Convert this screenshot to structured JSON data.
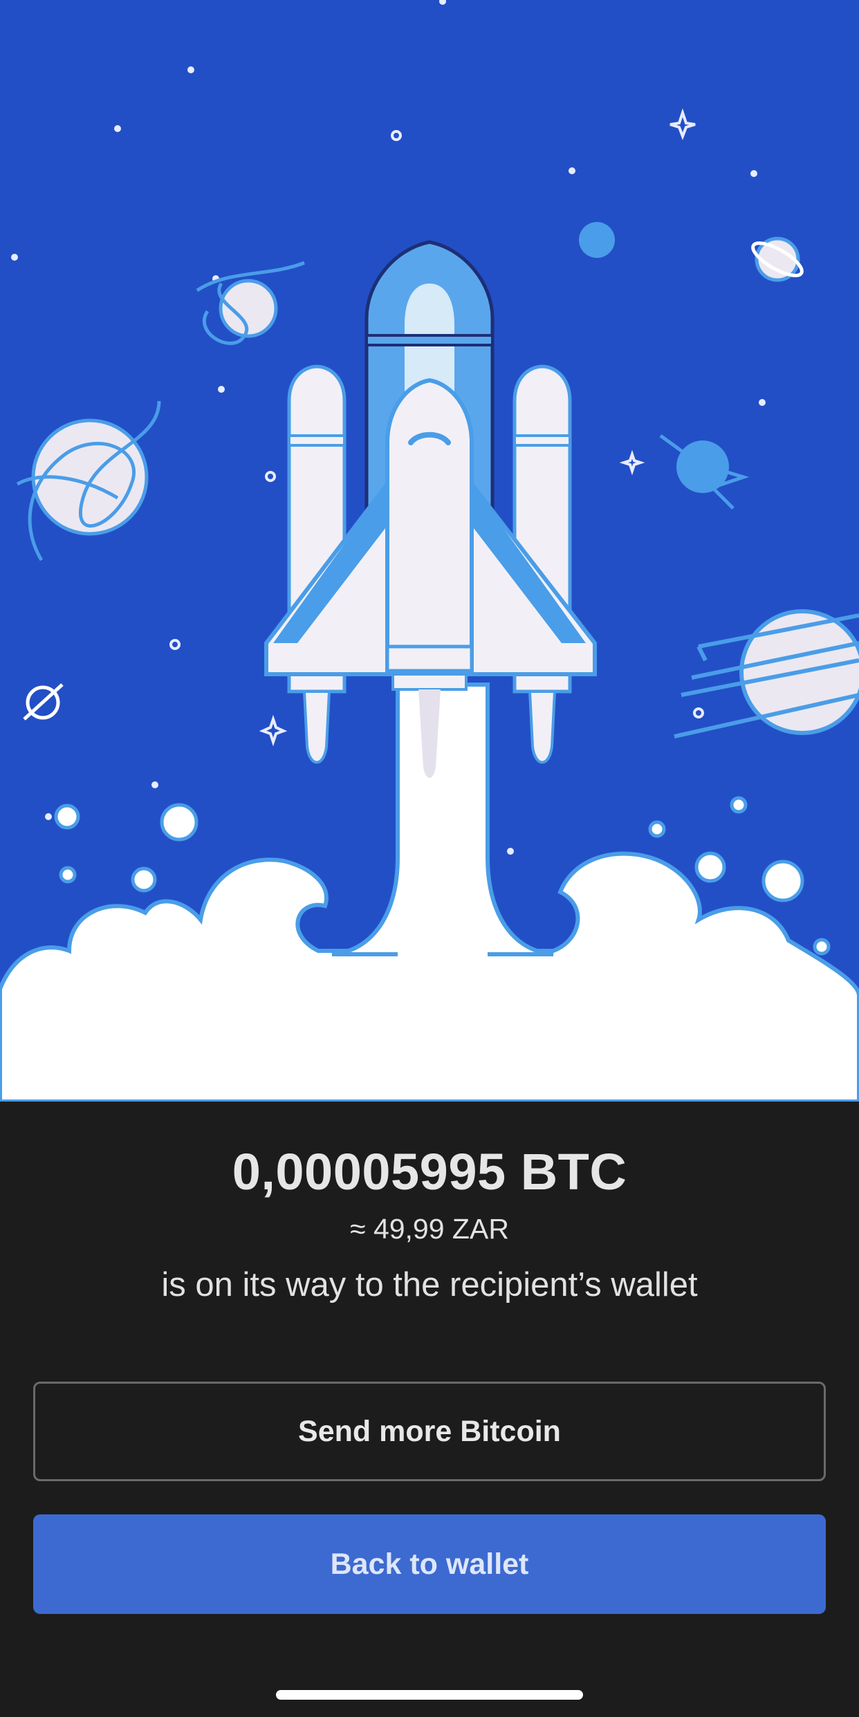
{
  "illustration": {
    "name": "rocket-launch-illustration",
    "colors": {
      "sky": "#224fc6",
      "rocket_light": "#5aa6ec",
      "rocket_white": "#f2f0f6",
      "planet": "#ebe8f2",
      "cloud": "#ffffff"
    }
  },
  "confirmation": {
    "amount": "0,00005995 BTC",
    "fiat_equivalent": "≈ 49,99 ZAR",
    "message": "is on its way to the recipient’s wallet"
  },
  "actions": {
    "send_more_label": "Send more Bitcoin",
    "back_label": "Back to wallet"
  },
  "colors": {
    "background": "#1c1c1c",
    "primary": "#3d6ad0",
    "outline_border": "#6a6a6a"
  }
}
